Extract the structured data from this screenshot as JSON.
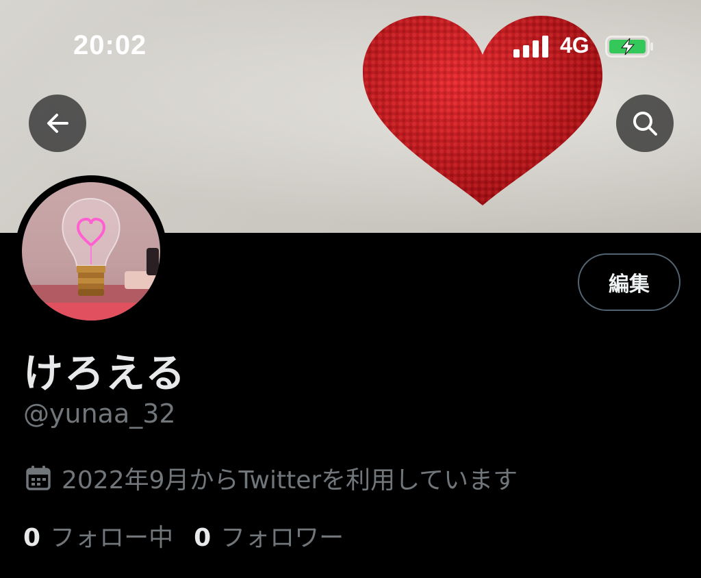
{
  "status_bar": {
    "time": "20:02",
    "network": "4G",
    "signal_icon": "cellular-signal-icon",
    "battery_icon": "battery-charging-icon"
  },
  "header": {
    "back_icon": "arrow-left-icon",
    "search_icon": "search-icon"
  },
  "banner": {
    "image": "red-knitted-heart"
  },
  "avatar": {
    "image": "pink-heart-lightbulb"
  },
  "profile": {
    "edit_label": "編集",
    "display_name": "けろえる",
    "handle": "@yunaa_32",
    "joined_icon": "calendar-icon",
    "joined_text": "2022年9月からTwitterを利用しています",
    "following_count": "0",
    "following_label": "フォロー中",
    "followers_count": "0",
    "followers_label": "フォロワー"
  },
  "colors": {
    "background": "#000000",
    "primary_text": "#e7e9ea",
    "secondary_text": "#71767b",
    "border": "#536471",
    "battery": "#34c759"
  }
}
